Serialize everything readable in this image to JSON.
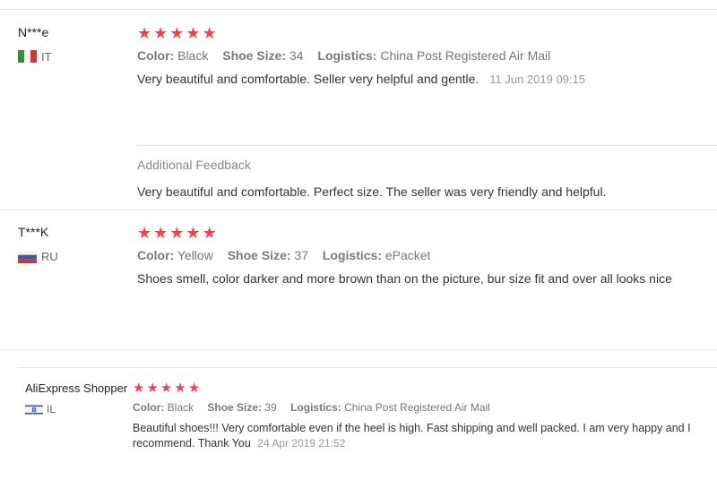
{
  "reviews": [
    {
      "name": "N***e",
      "country": "IT",
      "stars": 5,
      "color_label": "Color:",
      "color_value": "Black",
      "size_label": "Shoe Size:",
      "size_value": "34",
      "logistics_label": "Logistics:",
      "logistics_value": "China Post Registered Air Mail",
      "text": "Very beautiful and comfortable. Seller very helpful and gentle.",
      "timestamp": "11 Jun 2019 09:15",
      "additional_title": "Additional Feedback",
      "additional_text": "Very beautiful and comfortable. Perfect size. The seller was very friendly and helpful."
    },
    {
      "name": "T***K",
      "country": "RU",
      "stars": 5,
      "color_label": "Color:",
      "color_value": "Yellow",
      "size_label": "Shoe Size:",
      "size_value": "37",
      "logistics_label": "Logistics:",
      "logistics_value": "ePacket",
      "text": "Shoes smell, color darker and more brown than on the picture, bur size fit and over all looks nice"
    },
    {
      "name": "AliExpress Shopper",
      "country": "IL",
      "stars": 5,
      "color_label": "Color:",
      "color_value": "Black",
      "size_label": "Shoe Size:",
      "size_value": "39",
      "logistics_label": "Logistics:",
      "logistics_value": "China Post Registered Air Mail",
      "text_line1": "Beautiful shoes!!! Very comfortable even if the heel is high. Fast shipping and well packed. I am very happy and I",
      "text_line2": "recommend. Thank You",
      "timestamp": "24 Apr 2019 21:52"
    }
  ],
  "colors": {
    "star": "#e9474c",
    "divider": "#e6e6e6",
    "meta_label": "#7a7a7a"
  }
}
